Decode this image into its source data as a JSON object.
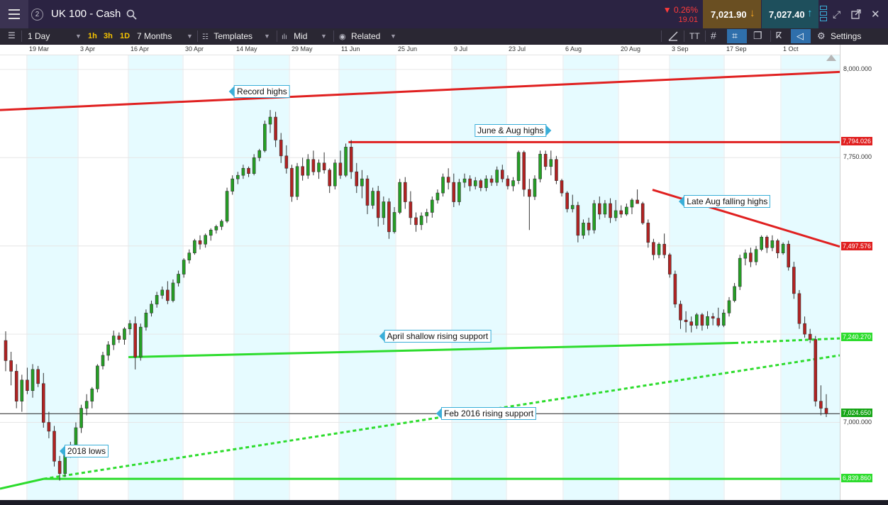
{
  "header": {
    "instrument": "UK 100 - Cash",
    "badge": "2",
    "change_pct": "▼ 0.26%",
    "change_abs": "19.01",
    "sell_price": "7,021.90",
    "buy_price": "7,027.40",
    "colors": {
      "header_bg": "#2b2342",
      "sell_bg": "#6a4f22",
      "buy_bg": "#1e4f5c",
      "change_color": "#ff3b3b"
    }
  },
  "toolbar": {
    "interval": "1 Day",
    "quick_intervals": [
      "1h",
      "3h",
      "1D"
    ],
    "range": "7 Months",
    "templates_label": "Templates",
    "price_type": "Mid",
    "related_label": "Related",
    "settings_label": "Settings",
    "icons": [
      "menu-icon",
      "search-icon",
      "candle-type-icon",
      "templates-icon",
      "related-icon",
      "draw-line-icon",
      "text-icon",
      "grid-icon",
      "crosshair-icon",
      "layers-icon",
      "fibonacci-icon",
      "annotation-icon",
      "settings-icon",
      "layout-icon",
      "expand-icon",
      "popout-icon",
      "close-icon"
    ]
  },
  "chart_data": {
    "type": "candlestick",
    "instrument": "UK 100 - Cash",
    "date_labels": [
      "19 Mar",
      "3 Apr",
      "16 Apr",
      "30 Apr",
      "14 May",
      "29 May",
      "11 Jun",
      "25 Jun",
      "9 Jul",
      "23 Jul",
      "6 Aug",
      "20 Aug",
      "3 Sep",
      "17 Sep",
      "1 Oct"
    ],
    "y_ticks": [
      "8,000.000",
      "7,750.000",
      "7,000.000"
    ],
    "ylim": [
      6780,
      8040
    ],
    "current_price": "7,024.650",
    "level_tags": [
      {
        "label": "7,794.026",
        "value": 7794,
        "color": "#e02020"
      },
      {
        "label": "7,497.576",
        "value": 7498,
        "color": "#e02020"
      },
      {
        "label": "7,240.270",
        "value": 7240,
        "color": "#2ddc2d"
      },
      {
        "label": "7,024.650",
        "value": 7025,
        "color": "#16a516"
      },
      {
        "label": "6,839.860",
        "value": 6840,
        "color": "#2ddc2d"
      }
    ],
    "trendlines": [
      {
        "name": "Record highs",
        "color": "#e02020",
        "style": "solid",
        "from": {
          "x": 0,
          "y": 7885
        },
        "to": {
          "x": 100,
          "y": 7993
        }
      },
      {
        "name": "June & Aug highs",
        "color": "#e02020",
        "style": "solid",
        "from": {
          "x": 41.5,
          "y": 7794
        },
        "to": {
          "x": 100,
          "y": 7794
        }
      },
      {
        "name": "Late Aug falling highs",
        "color": "#e02020",
        "style": "solid",
        "from": {
          "x": 77.7,
          "y": 7659
        },
        "to": {
          "x": 100,
          "y": 7498
        }
      },
      {
        "name": "April shallow rising support",
        "color": "#2ddc2d",
        "style": "solid",
        "from": {
          "x": 15.3,
          "y": 7185
        },
        "to": {
          "x": 87.5,
          "y": 7225
        }
      },
      {
        "name": "April shallow rising support (extension)",
        "color": "#2ddc2d",
        "style": "dashed",
        "from": {
          "x": 87.5,
          "y": 7225
        },
        "to": {
          "x": 100,
          "y": 7238
        }
      },
      {
        "name": "Feb 2016 rising support",
        "color": "#2ddc2d",
        "style": "solid",
        "from": {
          "x": 0,
          "y": 6812
        },
        "to": {
          "x": 5.2,
          "y": 6840
        }
      },
      {
        "name": "Feb 2016 rising support (extension)",
        "color": "#2ddc2d",
        "style": "dashed",
        "from": {
          "x": 5.2,
          "y": 6840
        },
        "to": {
          "x": 100,
          "y": 7190
        }
      },
      {
        "name": "2018 lows",
        "color": "#2ddc2d",
        "style": "solid",
        "from": {
          "x": 5.2,
          "y": 6840
        },
        "to": {
          "x": 100,
          "y": 6840
        }
      }
    ],
    "annotations": [
      {
        "text": "Record highs",
        "x": 31.2,
        "y": 7938,
        "arrow": "left"
      },
      {
        "text": "June & Aug highs",
        "x": 60.8,
        "y": 7826,
        "arrow": "right"
      },
      {
        "text": "Late Aug falling highs",
        "x": 86.6,
        "y": 7627,
        "arrow": "left"
      },
      {
        "text": "April shallow rising support",
        "x": 52.1,
        "y": 7244,
        "arrow": "left"
      },
      {
        "text": "Feb 2016 rising support",
        "x": 58.2,
        "y": 7026,
        "arrow": "left"
      },
      {
        "text": "2018 lows",
        "x": 10.3,
        "y": 6918,
        "arrow": "left"
      }
    ],
    "candles": [
      [
        7232,
        7258,
        7145,
        7175
      ],
      [
        7175,
        7200,
        7105,
        7145
      ],
      [
        7145,
        7165,
        7040,
        7060
      ],
      [
        7060,
        7135,
        7030,
        7120
      ],
      [
        7120,
        7155,
        7080,
        7090
      ],
      [
        7090,
        7165,
        7070,
        7150
      ],
      [
        7150,
        7160,
        7100,
        7110
      ],
      [
        7110,
        7140,
        6985,
        7000
      ],
      [
        7000,
        7030,
        6955,
        6975
      ],
      [
        6975,
        6990,
        6875,
        6890
      ],
      [
        6890,
        6905,
        6835,
        6855
      ],
      [
        6855,
        6935,
        6845,
        6915
      ],
      [
        6915,
        6945,
        6900,
        6935
      ],
      [
        6935,
        7000,
        6930,
        6985
      ],
      [
        6985,
        7050,
        6970,
        7040
      ],
      [
        7040,
        7080,
        7020,
        7060
      ],
      [
        7060,
        7100,
        7040,
        7095
      ],
      [
        7095,
        7165,
        7085,
        7160
      ],
      [
        7160,
        7200,
        7150,
        7190
      ],
      [
        7190,
        7230,
        7175,
        7220
      ],
      [
        7220,
        7260,
        7205,
        7245
      ],
      [
        7245,
        7255,
        7225,
        7235
      ],
      [
        7235,
        7270,
        7220,
        7265
      ],
      [
        7265,
        7290,
        7248,
        7280
      ],
      [
        7280,
        7300,
        7150,
        7185
      ],
      [
        7185,
        7280,
        7175,
        7270
      ],
      [
        7270,
        7320,
        7260,
        7310
      ],
      [
        7310,
        7345,
        7300,
        7335
      ],
      [
        7335,
        7370,
        7325,
        7360
      ],
      [
        7360,
        7385,
        7350,
        7375
      ],
      [
        7375,
        7400,
        7335,
        7345
      ],
      [
        7345,
        7405,
        7340,
        7395
      ],
      [
        7395,
        7430,
        7385,
        7420
      ],
      [
        7420,
        7465,
        7410,
        7460
      ],
      [
        7460,
        7490,
        7450,
        7480
      ],
      [
        7480,
        7520,
        7475,
        7515
      ],
      [
        7515,
        7530,
        7490,
        7505
      ],
      [
        7505,
        7535,
        7495,
        7530
      ],
      [
        7530,
        7550,
        7515,
        7545
      ],
      [
        7545,
        7560,
        7535,
        7555
      ],
      [
        7555,
        7575,
        7545,
        7570
      ],
      [
        7570,
        7665,
        7565,
        7655
      ],
      [
        7655,
        7700,
        7645,
        7690
      ],
      [
        7690,
        7710,
        7675,
        7700
      ],
      [
        7700,
        7730,
        7690,
        7720
      ],
      [
        7720,
        7725,
        7695,
        7705
      ],
      [
        7705,
        7760,
        7700,
        7750
      ],
      [
        7750,
        7775,
        7740,
        7770
      ],
      [
        7770,
        7855,
        7765,
        7845
      ],
      [
        7845,
        7885,
        7820,
        7865
      ],
      [
        7865,
        7880,
        7780,
        7800
      ],
      [
        7800,
        7820,
        7735,
        7755
      ],
      [
        7755,
        7785,
        7705,
        7720
      ],
      [
        7720,
        7730,
        7625,
        7640
      ],
      [
        7640,
        7735,
        7630,
        7725
      ],
      [
        7725,
        7750,
        7685,
        7700
      ],
      [
        7700,
        7760,
        7690,
        7745
      ],
      [
        7745,
        7770,
        7700,
        7710
      ],
      [
        7710,
        7745,
        7690,
        7735
      ],
      [
        7735,
        7765,
        7705,
        7715
      ],
      [
        7715,
        7720,
        7650,
        7670
      ],
      [
        7670,
        7745,
        7660,
        7735
      ],
      [
        7735,
        7770,
        7690,
        7700
      ],
      [
        7700,
        7790,
        7695,
        7780
      ],
      [
        7780,
        7800,
        7690,
        7710
      ],
      [
        7710,
        7735,
        7650,
        7670
      ],
      [
        7670,
        7715,
        7635,
        7690
      ],
      [
        7690,
        7700,
        7590,
        7615
      ],
      [
        7615,
        7665,
        7605,
        7655
      ],
      [
        7655,
        7670,
        7555,
        7580
      ],
      [
        7580,
        7640,
        7560,
        7625
      ],
      [
        7625,
        7635,
        7520,
        7540
      ],
      [
        7540,
        7610,
        7535,
        7595
      ],
      [
        7595,
        7690,
        7590,
        7680
      ],
      [
        7680,
        7695,
        7605,
        7625
      ],
      [
        7625,
        7655,
        7560,
        7580
      ],
      [
        7580,
        7595,
        7540,
        7560
      ],
      [
        7560,
        7595,
        7545,
        7585
      ],
      [
        7585,
        7605,
        7565,
        7595
      ],
      [
        7595,
        7640,
        7580,
        7630
      ],
      [
        7630,
        7660,
        7620,
        7650
      ],
      [
        7650,
        7705,
        7640,
        7695
      ],
      [
        7695,
        7720,
        7660,
        7680
      ],
      [
        7680,
        7705,
        7610,
        7625
      ],
      [
        7625,
        7690,
        7615,
        7680
      ],
      [
        7680,
        7705,
        7665,
        7690
      ],
      [
        7690,
        7700,
        7655,
        7670
      ],
      [
        7670,
        7695,
        7660,
        7685
      ],
      [
        7685,
        7690,
        7655,
        7665
      ],
      [
        7665,
        7700,
        7655,
        7690
      ],
      [
        7690,
        7700,
        7670,
        7680
      ],
      [
        7680,
        7725,
        7670,
        7715
      ],
      [
        7715,
        7730,
        7680,
        7690
      ],
      [
        7690,
        7700,
        7660,
        7670
      ],
      [
        7670,
        7695,
        7655,
        7685
      ],
      [
        7685,
        7770,
        7675,
        7765
      ],
      [
        7765,
        7770,
        7640,
        7660
      ],
      [
        7660,
        7690,
        7545,
        7640
      ],
      [
        7640,
        7700,
        7630,
        7690
      ],
      [
        7690,
        7770,
        7680,
        7760
      ],
      [
        7760,
        7770,
        7715,
        7725
      ],
      [
        7725,
        7770,
        7700,
        7745
      ],
      [
        7745,
        7755,
        7675,
        7685
      ],
      [
        7685,
        7690,
        7640,
        7650
      ],
      [
        7650,
        7655,
        7595,
        7605
      ],
      [
        7605,
        7645,
        7595,
        7615
      ],
      [
        7615,
        7625,
        7510,
        7530
      ],
      [
        7530,
        7575,
        7520,
        7565
      ],
      [
        7565,
        7580,
        7530,
        7545
      ],
      [
        7545,
        7630,
        7535,
        7620
      ],
      [
        7620,
        7640,
        7575,
        7590
      ],
      [
        7590,
        7630,
        7580,
        7620
      ],
      [
        7620,
        7635,
        7565,
        7580
      ],
      [
        7580,
        7630,
        7570,
        7600
      ],
      [
        7600,
        7615,
        7580,
        7590
      ],
      [
        7590,
        7620,
        7585,
        7610
      ],
      [
        7610,
        7635,
        7590,
        7630
      ],
      [
        7630,
        7660,
        7620,
        7620
      ],
      [
        7620,
        7625,
        7560,
        7565
      ],
      [
        7565,
        7575,
        7495,
        7510
      ],
      [
        7510,
        7520,
        7460,
        7475
      ],
      [
        7475,
        7510,
        7465,
        7505
      ],
      [
        7505,
        7535,
        7465,
        7475
      ],
      [
        7475,
        7480,
        7410,
        7420
      ],
      [
        7420,
        7430,
        7325,
        7335
      ],
      [
        7335,
        7345,
        7265,
        7290
      ],
      [
        7290,
        7315,
        7255,
        7285
      ],
      [
        7285,
        7300,
        7255,
        7275
      ],
      [
        7275,
        7310,
        7265,
        7305
      ],
      [
        7305,
        7310,
        7260,
        7275
      ],
      [
        7275,
        7315,
        7265,
        7300
      ],
      [
        7300,
        7310,
        7275,
        7295
      ],
      [
        7295,
        7325,
        7270,
        7275
      ],
      [
        7275,
        7320,
        7270,
        7310
      ],
      [
        7310,
        7355,
        7300,
        7345
      ],
      [
        7345,
        7395,
        7340,
        7385
      ],
      [
        7385,
        7475,
        7375,
        7465
      ],
      [
        7465,
        7490,
        7445,
        7480
      ],
      [
        7480,
        7495,
        7440,
        7455
      ],
      [
        7455,
        7500,
        7445,
        7490
      ],
      [
        7490,
        7530,
        7485,
        7525
      ],
      [
        7525,
        7530,
        7480,
        7495
      ],
      [
        7495,
        7530,
        7485,
        7515
      ],
      [
        7515,
        7520,
        7465,
        7480
      ],
      [
        7480,
        7510,
        7475,
        7505
      ],
      [
        7505,
        7515,
        7430,
        7440
      ],
      [
        7440,
        7455,
        7350,
        7365
      ],
      [
        7365,
        7375,
        7265,
        7280
      ],
      [
        7280,
        7300,
        7240,
        7250
      ],
      [
        7250,
        7265,
        7225,
        7235
      ],
      [
        7235,
        7245,
        7045,
        7060
      ],
      [
        7060,
        7105,
        7020,
        7040
      ],
      [
        7040,
        7080,
        7015,
        7025
      ]
    ]
  }
}
